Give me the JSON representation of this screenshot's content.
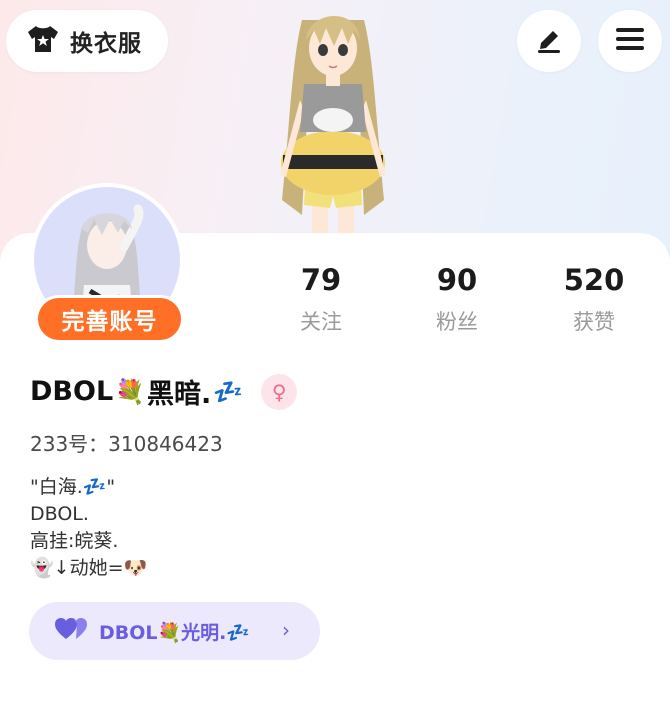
{
  "header": {
    "wardrobe_label": "换衣服",
    "wardrobe_icon": "shirt-icon",
    "edit_icon": "pencil-icon",
    "menu_icon": "hamburger-menu-icon"
  },
  "profile": {
    "complete_account_label": "完善账号",
    "stats": [
      {
        "value": "79",
        "label": "关注"
      },
      {
        "value": "90",
        "label": "粉丝"
      },
      {
        "value": "520",
        "label": "获赞"
      }
    ],
    "name_prefix": "DBOL",
    "name_emoji": "💐",
    "name_suffix": "黑暗.",
    "name_zzz": "💤",
    "gender_symbol": "♀",
    "uid_line": "233号：310846423",
    "bio_lines": [
      "\"白海.💤\"",
      "DBOL.",
      "高挂:皖葵.",
      "👻↓动她=🐶"
    ]
  },
  "cp_link": {
    "icon": "double-heart-icon",
    "text": "DBOL💐光明.💤",
    "chevron": "›"
  },
  "colors": {
    "orange": "#ff6f26",
    "purple": "#6a5ee0",
    "pill_bg": "#ebe9fb",
    "gender_pink": "#f06a8a"
  }
}
